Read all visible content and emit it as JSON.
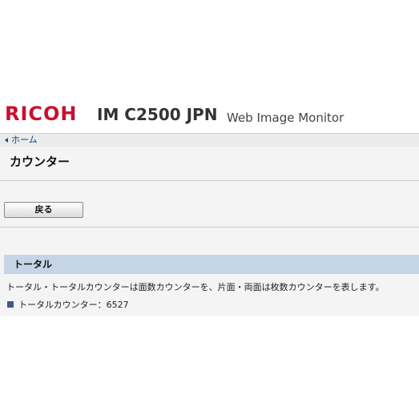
{
  "header": {
    "logo_text": "RICOH",
    "model": "IM C2500 JPN",
    "product": "Web Image Monitor"
  },
  "breadcrumb": {
    "home_label": "ホーム"
  },
  "page": {
    "title": "カウンター"
  },
  "toolbar": {
    "back_label": "戻る"
  },
  "section": {
    "title": "トータル",
    "description": "トータル・トータルカウンターは面数カウンターを、片面・両面は枚数カウンターを表します。",
    "counter_label": "トータルカウンター",
    "counter_separator": "：",
    "counter_value": "6527"
  },
  "colors": {
    "brand_red": "#c8102e",
    "section_header_bg": "#c6d4e7",
    "link_blue": "#1a3d8f",
    "bullet_blue": "#3d5a8a"
  },
  "icons": {
    "breadcrumb_arrow": "chevron-left-icon",
    "list_bullet": "square-bullet-icon"
  }
}
